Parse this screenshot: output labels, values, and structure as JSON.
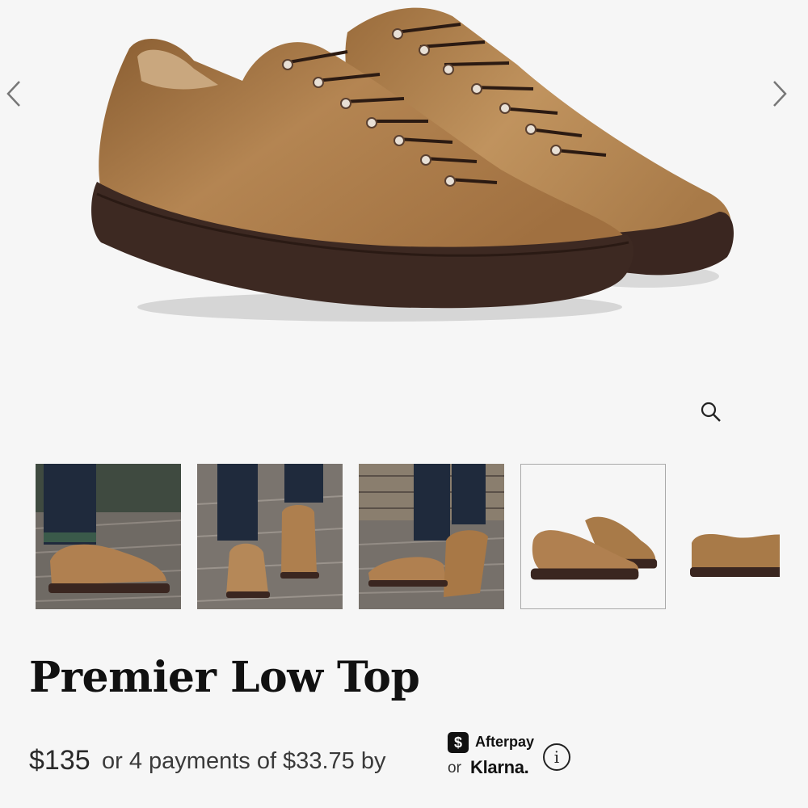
{
  "gallery": {
    "main_image": "premier-low-top-natural-pair",
    "prev_icon": "chevron-left-icon",
    "next_icon": "chevron-right-icon",
    "zoom_icon": "magnifier-icon",
    "thumbnails": [
      {
        "name": "lifestyle-side-view",
        "selected": false
      },
      {
        "name": "lifestyle-front-view",
        "selected": false
      },
      {
        "name": "lifestyle-angled-view",
        "selected": false
      },
      {
        "name": "product-pair-view",
        "selected": true
      },
      {
        "name": "product-side-view",
        "selected": false
      }
    ]
  },
  "product": {
    "title": "Premier Low Top",
    "price": "$135",
    "installments_text": "or 4 payments of $33.75 by"
  },
  "payment": {
    "afterpay_badge": "$",
    "afterpay_label": "Afterpay",
    "or_label": "or",
    "klarna_label": "Klarna.",
    "info_glyph": "i"
  },
  "colors": {
    "background": "#f6f6f6",
    "leather": "#a87a4a",
    "sole": "#3a2620",
    "text": "#111111"
  }
}
